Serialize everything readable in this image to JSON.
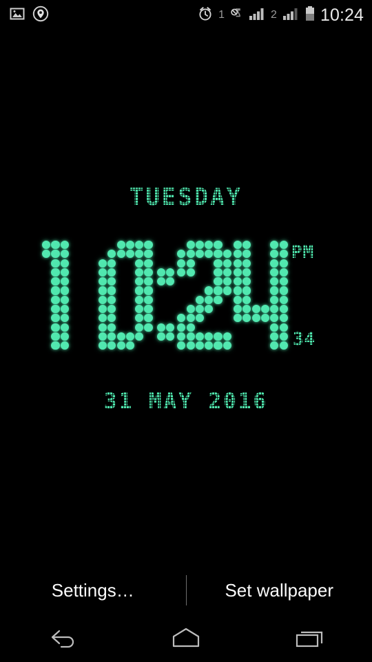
{
  "status_bar": {
    "left_icons": [
      {
        "name": "photo-icon",
        "label": "Screenshot / image notification"
      },
      {
        "name": "location-badge-icon",
        "label": "Location service active"
      }
    ],
    "alarm_icon_label": "Alarm set",
    "sim1_label": "1",
    "mute_icon_label": "Vibrate / silent",
    "sim2_label": "2",
    "battery_icon_label": "Battery",
    "clock": "10:24"
  },
  "clock_widget": {
    "weekday": "TUESDAY",
    "time": "10:24",
    "hours": "10",
    "minutes": "24",
    "ampm": "PM",
    "seconds": "34",
    "date": "31 MAY 2016",
    "led_color": "#52e8b0",
    "background_color": "#000000"
  },
  "action_bar": {
    "settings_label": "Settings…",
    "set_wallpaper_label": "Set wallpaper"
  },
  "nav_bar": {
    "back_label": "Back",
    "home_label": "Home",
    "recents_label": "Recent apps"
  }
}
